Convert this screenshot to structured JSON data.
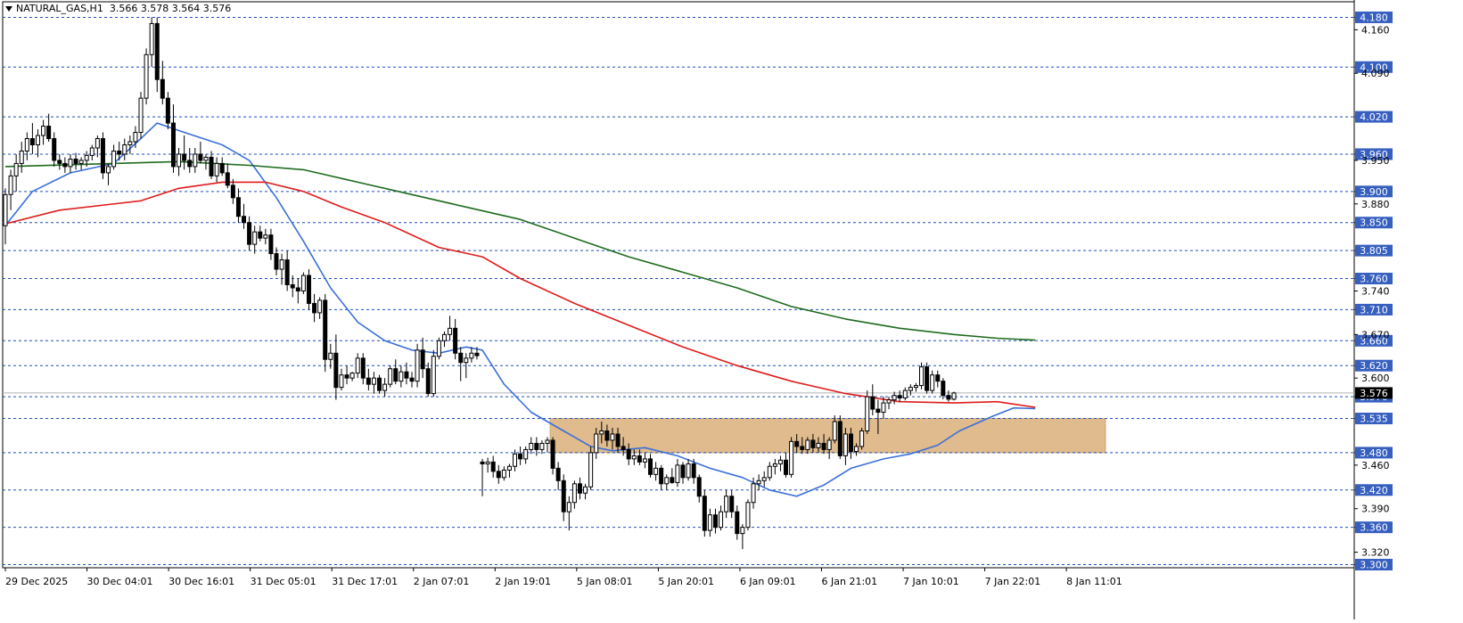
{
  "header": {
    "symbol": "NATURAL_GAS,H1",
    "ohlc": "3.566 3.578 3.564 3.576"
  },
  "colors": {
    "background": "#ffffff",
    "grid_line": "#1f4fbf",
    "level_box_fill": "#365fbf",
    "level_box_text": "#ffffff",
    "ma_fast": "#3a6fd8",
    "ma_medium": "#e01b1b",
    "ma_slow": "#1e6b1e",
    "zone_fill": "#deb887",
    "candle_bull_fill": "#ffffff",
    "candle_bear_fill": "#000000",
    "candle_outline": "#000000",
    "current_price_line": "#b0b0b0",
    "current_price_box": "#000000"
  },
  "chart_data": {
    "type": "candlestick",
    "timeframe": "H1",
    "y_range": [
      3.295,
      4.205
    ],
    "resistance_support_levels": [
      4.18,
      4.1,
      4.02,
      3.96,
      3.9,
      3.85,
      3.805,
      3.76,
      3.71,
      3.66,
      3.62,
      3.57,
      3.535,
      3.48,
      3.42,
      3.36,
      3.3
    ],
    "price_ticks": [
      "4.160",
      "4.090",
      "3.950",
      "3.880",
      "3.740",
      "3.670",
      "3.600",
      "3.460",
      "3.390",
      "3.320"
    ],
    "current_price": "3.576",
    "time_labels": [
      "29 Dec 2025",
      "30 Dec 04:01",
      "30 Dec 16:01",
      "31 Dec 05:01",
      "31 Dec 17:01",
      "2 Jan 07:01",
      "2 Jan 19:01",
      "5 Jan 08:01",
      "5 Jan 20:01",
      "6 Jan 09:01",
      "6 Jan 21:01",
      "7 Jan 10:01",
      "7 Jan 22:01",
      "8 Jan 11:01"
    ],
    "zone": {
      "from": 3.48,
      "to": 3.535
    },
    "candles": [
      [
        3.845,
        3.905,
        3.815,
        3.895
      ],
      [
        3.895,
        3.935,
        3.87,
        3.925
      ],
      [
        3.925,
        3.96,
        3.9,
        3.945
      ],
      [
        3.945,
        3.98,
        3.93,
        3.965
      ],
      [
        3.965,
        3.995,
        3.95,
        3.985
      ],
      [
        3.985,
        4.01,
        3.96,
        3.975
      ],
      [
        3.975,
        4.0,
        3.955,
        3.99
      ],
      [
        3.99,
        4.015,
        3.975,
        4.005
      ],
      [
        4.005,
        4.025,
        3.98,
        3.985
      ],
      [
        3.985,
        3.995,
        3.94,
        3.95
      ],
      [
        3.95,
        3.96,
        3.935,
        3.945
      ],
      [
        3.945,
        3.955,
        3.93,
        3.94
      ],
      [
        3.94,
        3.96,
        3.93,
        3.952
      ],
      [
        3.952,
        3.962,
        3.935,
        3.945
      ],
      [
        3.945,
        3.955,
        3.935,
        3.95
      ],
      [
        3.95,
        3.965,
        3.94,
        3.958
      ],
      [
        3.958,
        3.975,
        3.95,
        3.97
      ],
      [
        3.97,
        3.99,
        3.955,
        3.985
      ],
      [
        3.985,
        3.995,
        3.92,
        3.93
      ],
      [
        3.93,
        3.945,
        3.91,
        3.94
      ],
      [
        3.94,
        3.975,
        3.935,
        3.965
      ],
      [
        3.965,
        3.98,
        3.95,
        3.96
      ],
      [
        3.96,
        3.985,
        3.95,
        3.975
      ],
      [
        3.975,
        3.99,
        3.96,
        3.98
      ],
      [
        3.98,
        4.005,
        3.97,
        3.995
      ],
      [
        3.995,
        4.06,
        3.985,
        4.05
      ],
      [
        4.05,
        4.13,
        4.04,
        4.12
      ],
      [
        4.12,
        4.18,
        4.1,
        4.17
      ],
      [
        4.17,
        4.18,
        4.06,
        4.08
      ],
      [
        4.08,
        4.11,
        4.04,
        4.05
      ],
      [
        4.05,
        4.06,
        4.0,
        4.01
      ],
      [
        4.01,
        4.04,
        3.93,
        3.94
      ],
      [
        3.94,
        3.97,
        3.925,
        3.96
      ],
      [
        3.96,
        3.99,
        3.935,
        3.95
      ],
      [
        3.95,
        3.97,
        3.93,
        3.94
      ],
      [
        3.94,
        3.97,
        3.93,
        3.96
      ],
      [
        3.96,
        3.98,
        3.945,
        3.95
      ],
      [
        3.95,
        3.96,
        3.935,
        3.955
      ],
      [
        3.955,
        3.965,
        3.92,
        3.925
      ],
      [
        3.925,
        3.955,
        3.915,
        3.945
      ],
      [
        3.945,
        3.955,
        3.925,
        3.93
      ],
      [
        3.93,
        3.945,
        3.905,
        3.91
      ],
      [
        3.91,
        3.92,
        3.88,
        3.89
      ],
      [
        3.89,
        3.905,
        3.85,
        3.86
      ],
      [
        3.86,
        3.88,
        3.84,
        3.85
      ],
      [
        3.85,
        3.86,
        3.805,
        3.815
      ],
      [
        3.815,
        3.845,
        3.8,
        3.835
      ],
      [
        3.835,
        3.845,
        3.82,
        3.825
      ],
      [
        3.825,
        3.84,
        3.815,
        3.83
      ],
      [
        3.83,
        3.84,
        3.79,
        3.8
      ],
      [
        3.8,
        3.81,
        3.765,
        3.775
      ],
      [
        3.775,
        3.8,
        3.75,
        3.79
      ],
      [
        3.79,
        3.805,
        3.74,
        3.75
      ],
      [
        3.75,
        3.765,
        3.73,
        3.745
      ],
      [
        3.745,
        3.76,
        3.72,
        3.74
      ],
      [
        3.74,
        3.77,
        3.735,
        3.765
      ],
      [
        3.765,
        3.775,
        3.71,
        3.72
      ],
      [
        3.72,
        3.735,
        3.69,
        3.705
      ],
      [
        3.705,
        3.73,
        3.695,
        3.725
      ],
      [
        3.725,
        3.735,
        3.61,
        3.63
      ],
      [
        3.63,
        3.655,
        3.615,
        3.64
      ],
      [
        3.64,
        3.67,
        3.565,
        3.585
      ],
      [
        3.585,
        3.615,
        3.58,
        3.605
      ],
      [
        3.605,
        3.62,
        3.59,
        3.6
      ],
      [
        3.6,
        3.61,
        3.595,
        3.608
      ],
      [
        3.608,
        3.64,
        3.6,
        3.632
      ],
      [
        3.632,
        3.64,
        3.59,
        3.6
      ],
      [
        3.6,
        3.615,
        3.58,
        3.59
      ],
      [
        3.59,
        3.61,
        3.575,
        3.6
      ],
      [
        3.6,
        3.605,
        3.575,
        3.58
      ],
      [
        3.58,
        3.6,
        3.57,
        3.59
      ],
      [
        3.59,
        3.62,
        3.585,
        3.615
      ],
      [
        3.615,
        3.63,
        3.59,
        3.595
      ],
      [
        3.595,
        3.62,
        3.585,
        3.61
      ],
      [
        3.61,
        3.625,
        3.59,
        3.6
      ],
      [
        3.6,
        3.61,
        3.585,
        3.595
      ],
      [
        3.595,
        3.655,
        3.585,
        3.645
      ],
      [
        3.645,
        3.665,
        3.6,
        3.615
      ],
      [
        3.615,
        3.625,
        3.57,
        3.575
      ],
      [
        3.575,
        3.645,
        3.57,
        3.635
      ],
      [
        3.635,
        3.665,
        3.63,
        3.66
      ],
      [
        3.66,
        3.675,
        3.65,
        3.67
      ],
      [
        3.67,
        3.7,
        3.66,
        3.68
      ],
      [
        3.68,
        3.695,
        3.63,
        3.64
      ],
      [
        3.64,
        3.65,
        3.595,
        3.625
      ],
      [
        3.625,
        3.64,
        3.6,
        3.632
      ],
      [
        3.632,
        3.65,
        3.625,
        3.64
      ],
      [
        3.64,
        3.65,
        3.63,
        3.636
      ],
      [
        3.465,
        3.47,
        3.41,
        3.462
      ],
      [
        3.462,
        3.472,
        3.448,
        3.465
      ],
      [
        3.465,
        3.475,
        3.44,
        3.45
      ],
      [
        3.45,
        3.46,
        3.43,
        3.44
      ],
      [
        3.44,
        3.458,
        3.435,
        3.452
      ],
      [
        3.452,
        3.462,
        3.44,
        3.458
      ],
      [
        3.458,
        3.485,
        3.45,
        3.478
      ],
      [
        3.478,
        3.49,
        3.46,
        3.47
      ],
      [
        3.47,
        3.49,
        3.462,
        3.485
      ],
      [
        3.485,
        3.505,
        3.478,
        3.495
      ],
      [
        3.495,
        3.505,
        3.475,
        3.485
      ],
      [
        3.485,
        3.5,
        3.478,
        3.495
      ],
      [
        3.495,
        3.505,
        3.48,
        3.5
      ],
      [
        3.5,
        3.505,
        3.445,
        3.455
      ],
      [
        3.455,
        3.465,
        3.42,
        3.435
      ],
      [
        3.435,
        3.445,
        3.37,
        3.385
      ],
      [
        3.385,
        3.41,
        3.355,
        3.4
      ],
      [
        3.4,
        3.435,
        3.39,
        3.43
      ],
      [
        3.43,
        3.44,
        3.405,
        3.415
      ],
      [
        3.415,
        3.43,
        3.405,
        3.425
      ],
      [
        3.425,
        3.49,
        3.42,
        3.48
      ],
      [
        3.48,
        3.52,
        3.47,
        3.51
      ],
      [
        3.51,
        3.53,
        3.495,
        3.515
      ],
      [
        3.515,
        3.525,
        3.49,
        3.5
      ],
      [
        3.5,
        3.52,
        3.485,
        3.51
      ],
      [
        3.51,
        3.52,
        3.48,
        3.49
      ],
      [
        3.49,
        3.505,
        3.475,
        3.485
      ],
      [
        3.485,
        3.495,
        3.46,
        3.47
      ],
      [
        3.47,
        3.485,
        3.46,
        3.475
      ],
      [
        3.475,
        3.485,
        3.46,
        3.465
      ],
      [
        3.465,
        3.48,
        3.455,
        3.47
      ],
      [
        3.47,
        3.478,
        3.44,
        3.445
      ],
      [
        3.445,
        3.465,
        3.435,
        3.455
      ],
      [
        3.455,
        3.46,
        3.42,
        3.43
      ],
      [
        3.43,
        3.445,
        3.42,
        3.44
      ],
      [
        3.44,
        3.455,
        3.43,
        3.432
      ],
      [
        3.432,
        3.47,
        3.425,
        3.46
      ],
      [
        3.46,
        3.465,
        3.43,
        3.44
      ],
      [
        3.44,
        3.47,
        3.435,
        3.462
      ],
      [
        3.462,
        3.47,
        3.43,
        3.44
      ],
      [
        3.44,
        3.445,
        3.4,
        3.41
      ],
      [
        3.41,
        3.42,
        3.345,
        3.355
      ],
      [
        3.355,
        3.39,
        3.345,
        3.38
      ],
      [
        3.38,
        3.39,
        3.35,
        3.36
      ],
      [
        3.36,
        3.395,
        3.355,
        3.385
      ],
      [
        3.385,
        3.42,
        3.375,
        3.41
      ],
      [
        3.41,
        3.42,
        3.375,
        3.385
      ],
      [
        3.385,
        3.395,
        3.34,
        3.35
      ],
      [
        3.35,
        3.365,
        3.325,
        3.36
      ],
      [
        3.36,
        3.405,
        3.355,
        3.4
      ],
      [
        3.4,
        3.44,
        3.39,
        3.43
      ],
      [
        3.43,
        3.445,
        3.42,
        3.435
      ],
      [
        3.435,
        3.45,
        3.425,
        3.44
      ],
      [
        3.44,
        3.465,
        3.435,
        3.458
      ],
      [
        3.458,
        3.47,
        3.445,
        3.462
      ],
      [
        3.462,
        3.475,
        3.45,
        3.468
      ],
      [
        3.468,
        3.48,
        3.44,
        3.445
      ],
      [
        3.445,
        3.505,
        3.44,
        3.498
      ],
      [
        3.498,
        3.51,
        3.48,
        3.49
      ],
      [
        3.49,
        3.505,
        3.478,
        3.485
      ],
      [
        3.485,
        3.505,
        3.478,
        3.5
      ],
      [
        3.5,
        3.51,
        3.48,
        3.488
      ],
      [
        3.488,
        3.505,
        3.48,
        3.495
      ],
      [
        3.495,
        3.51,
        3.478,
        3.485
      ],
      [
        3.485,
        3.505,
        3.47,
        3.5
      ],
      [
        3.5,
        3.54,
        3.495,
        3.53
      ],
      [
        3.53,
        3.54,
        3.47,
        3.475
      ],
      [
        3.475,
        3.52,
        3.46,
        3.51
      ],
      [
        3.51,
        3.52,
        3.47,
        3.482
      ],
      [
        3.482,
        3.495,
        3.475,
        3.49
      ],
      [
        3.49,
        3.52,
        3.485,
        3.515
      ],
      [
        3.515,
        3.58,
        3.51,
        3.57
      ],
      [
        3.57,
        3.59,
        3.54,
        3.55
      ],
      [
        3.55,
        3.565,
        3.51,
        3.545
      ],
      [
        3.545,
        3.57,
        3.535,
        3.56
      ],
      [
        3.56,
        3.57,
        3.55,
        3.565
      ],
      [
        3.565,
        3.578,
        3.558,
        3.572
      ],
      [
        3.572,
        3.58,
        3.562,
        3.568
      ],
      [
        3.568,
        3.585,
        3.564,
        3.58
      ],
      [
        3.58,
        3.59,
        3.572,
        3.585
      ],
      [
        3.585,
        3.592,
        3.578,
        3.588
      ],
      [
        3.588,
        3.625,
        3.582,
        3.618
      ],
      [
        3.618,
        3.625,
        3.575,
        3.58
      ],
      [
        3.58,
        3.612,
        3.575,
        3.605
      ],
      [
        3.605,
        3.612,
        3.585,
        3.595
      ],
      [
        3.595,
        3.6,
        3.566,
        3.572
      ],
      [
        3.572,
        3.58,
        3.562,
        3.566
      ],
      [
        3.566,
        3.578,
        3.564,
        3.576
      ]
    ],
    "series": [
      {
        "values": [
          [
            0,
            3.845
          ],
          [
            5,
            3.9
          ],
          [
            12,
            3.93
          ],
          [
            20,
            3.945
          ],
          [
            25,
            3.985
          ],
          [
            28,
            4.01
          ],
          [
            33,
            3.995
          ],
          [
            40,
            3.975
          ],
          [
            45,
            3.95
          ],
          [
            50,
            3.89
          ],
          [
            55,
            3.82
          ],
          [
            60,
            3.745
          ],
          [
            65,
            3.69
          ],
          [
            70,
            3.66
          ],
          [
            75,
            3.645
          ],
          [
            80,
            3.64
          ],
          [
            85,
            3.65
          ],
          [
            88,
            3.645
          ],
          [
            92,
            3.59
          ],
          [
            97,
            3.545
          ],
          [
            103,
            3.515
          ],
          [
            108,
            3.49
          ],
          [
            112,
            3.483
          ],
          [
            118,
            3.488
          ],
          [
            124,
            3.475
          ],
          [
            130,
            3.455
          ],
          [
            136,
            3.44
          ],
          [
            141,
            3.42
          ],
          [
            146,
            3.41
          ],
          [
            151,
            3.428
          ],
          [
            156,
            3.455
          ],
          [
            162,
            3.47
          ],
          [
            167,
            3.478
          ],
          [
            172,
            3.492
          ],
          [
            176,
            3.515
          ],
          [
            182,
            3.538
          ],
          [
            186,
            3.552
          ],
          [
            190,
            3.551
          ]
        ]
      },
      {
        "values": [
          [
            0,
            3.848
          ],
          [
            10,
            3.87
          ],
          [
            25,
            3.885
          ],
          [
            32,
            3.905
          ],
          [
            40,
            3.915
          ],
          [
            48,
            3.915
          ],
          [
            55,
            3.9
          ],
          [
            62,
            3.875
          ],
          [
            70,
            3.85
          ],
          [
            80,
            3.81
          ],
          [
            88,
            3.795
          ],
          [
            95,
            3.76
          ],
          [
            105,
            3.72
          ],
          [
            115,
            3.685
          ],
          [
            125,
            3.65
          ],
          [
            135,
            3.62
          ],
          [
            145,
            3.595
          ],
          [
            155,
            3.575
          ],
          [
            165,
            3.562
          ],
          [
            175,
            3.56
          ],
          [
            183,
            3.562
          ],
          [
            190,
            3.553
          ]
        ]
      },
      {
        "values": [
          [
            0,
            3.94
          ],
          [
            20,
            3.945
          ],
          [
            32,
            3.948
          ],
          [
            45,
            3.942
          ],
          [
            55,
            3.935
          ],
          [
            65,
            3.915
          ],
          [
            75,
            3.895
          ],
          [
            85,
            3.875
          ],
          [
            95,
            3.855
          ],
          [
            105,
            3.825
          ],
          [
            115,
            3.795
          ],
          [
            125,
            3.77
          ],
          [
            135,
            3.745
          ],
          [
            145,
            3.715
          ],
          [
            155,
            3.695
          ],
          [
            165,
            3.68
          ],
          [
            175,
            3.67
          ],
          [
            183,
            3.664
          ],
          [
            190,
            3.661
          ]
        ]
      }
    ]
  }
}
